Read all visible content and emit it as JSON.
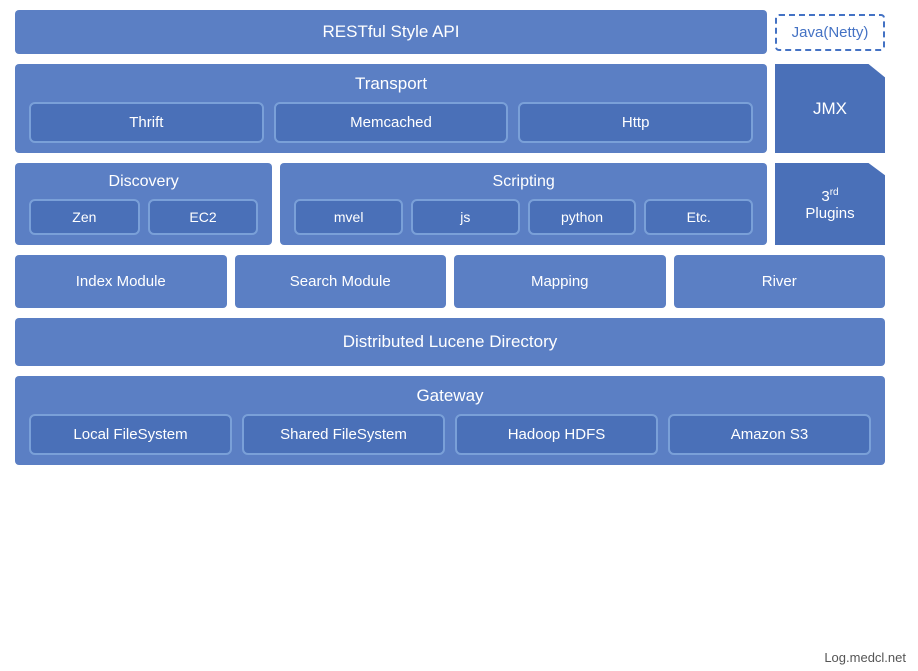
{
  "restful": {
    "label": "RESTful Style API"
  },
  "java_netty": {
    "label": "Java(Netty)"
  },
  "transport": {
    "title": "Transport",
    "items": [
      "Thrift",
      "Memcached",
      "Http"
    ]
  },
  "jmx": {
    "label": "JMX"
  },
  "discovery": {
    "title": "Discovery",
    "items": [
      "Zen",
      "EC2"
    ]
  },
  "scripting": {
    "title": "Scripting",
    "items": [
      "mvel",
      "js",
      "python",
      "Etc."
    ]
  },
  "plugins": {
    "sup": "rd",
    "label": "Plugins",
    "ordinal": "3"
  },
  "modules": {
    "index": "Index Module",
    "search": "Search Module",
    "mapping": "Mapping",
    "river": "River"
  },
  "lucene": {
    "label": "Distributed Lucene Directory"
  },
  "gateway": {
    "title": "Gateway",
    "items": [
      "Local FileSystem",
      "Shared FileSystem",
      "Hadoop HDFS",
      "Amazon S3"
    ]
  },
  "watermark": {
    "label": "Log.medcl.net"
  }
}
